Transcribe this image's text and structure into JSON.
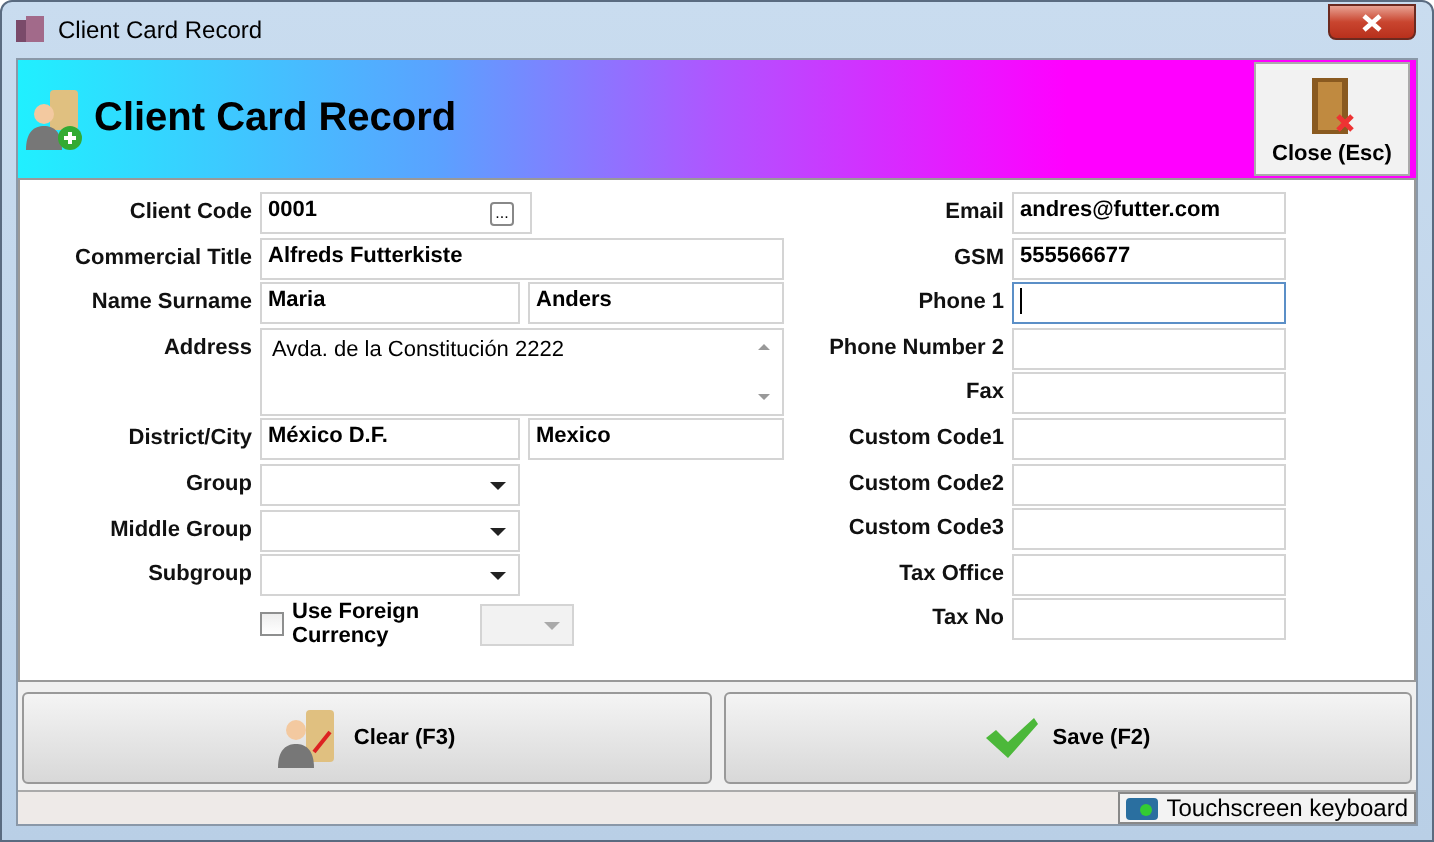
{
  "window": {
    "title": "Client Card Record"
  },
  "header": {
    "title": "Client Card Record",
    "close_button": "Close (Esc)"
  },
  "left_fields": [
    {
      "kind": "lookup",
      "label": "Client Code",
      "value": "0001",
      "button": "..."
    },
    {
      "kind": "text",
      "label": "Commercial Title",
      "value": "Alfreds Futterkiste"
    },
    {
      "kind": "pair",
      "label": "Name Surname",
      "value": "Maria",
      "value2": "Anders"
    },
    {
      "kind": "memo",
      "label": "Address",
      "value": "Avda. de la Constitución 2222"
    },
    {
      "kind": "pair",
      "label": "District/City",
      "value": "México D.F.",
      "value2": "Mexico"
    },
    {
      "kind": "dropdown",
      "label": "Group"
    },
    {
      "kind": "dropdown",
      "label": "Middle Group"
    },
    {
      "kind": "dropdown",
      "label": "Subgroup"
    },
    {
      "kind": "checkbox",
      "label": "Use Foreign Currency",
      "checked": false,
      "dropdown_disabled": true
    }
  ],
  "right_fields": [
    {
      "label": "Email",
      "value": "andres@futter.com",
      "focused": false
    },
    {
      "label": "GSM",
      "value": "555566677",
      "focused": false
    },
    {
      "label": "Phone 1",
      "focused": true
    },
    {
      "label": "Phone Number 2",
      "focused": false
    },
    {
      "label": "Fax",
      "focused": false
    },
    {
      "label": "Custom Code1",
      "focused": false
    },
    {
      "label": "Custom Code2",
      "focused": false
    },
    {
      "label": "Custom Code3",
      "focused": false
    },
    {
      "label": "Tax Office",
      "focused": false
    },
    {
      "label": "Tax No",
      "focused": false
    }
  ],
  "buttons": [
    {
      "kind": "clear",
      "label": "Clear (F3)"
    },
    {
      "kind": "save",
      "label": "Save (F2)"
    }
  ],
  "status_bar": {
    "keyboard_button": "Touchscreen keyboard"
  }
}
